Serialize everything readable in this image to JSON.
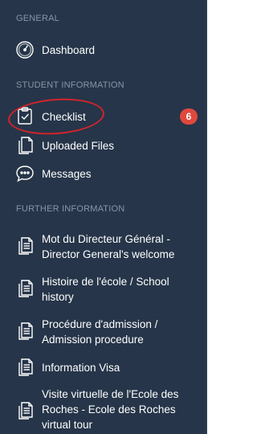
{
  "sections": {
    "general": "GENERAL",
    "student_information": "STUDENT INFORMATION",
    "further_information": "FURTHER INFORMATION"
  },
  "items": {
    "dashboard": {
      "label": "Dashboard",
      "icon": "speedometer-icon"
    },
    "checklist": {
      "label": "Checklist",
      "icon": "clipboard-check-icon",
      "badge": "6"
    },
    "uploaded_files": {
      "label": "Uploaded Files",
      "icon": "files-icon"
    },
    "messages": {
      "label": "Messages",
      "icon": "chat-icon"
    },
    "directors_welcome": {
      "label": "Mot du Directeur Général - Director General's welcome",
      "icon": "document-icon"
    },
    "school_history": {
      "label": "Histoire de l'école / School history",
      "icon": "document-icon"
    },
    "admission_procedure": {
      "label": "Procédure d'admission / Admission procedure",
      "icon": "document-icon"
    },
    "information_visa": {
      "label": "Information Visa",
      "icon": "document-icon"
    },
    "virtual_tour": {
      "label": "Visite virtuelle de l'Ecole des Roches - Ecole des Roches virtual tour",
      "icon": "document-icon"
    }
  },
  "colors": {
    "sidebar_bg": "#263549",
    "section_header": "#8896a8",
    "badge": "#e0483e",
    "highlight_circle": "#d2242a"
  }
}
